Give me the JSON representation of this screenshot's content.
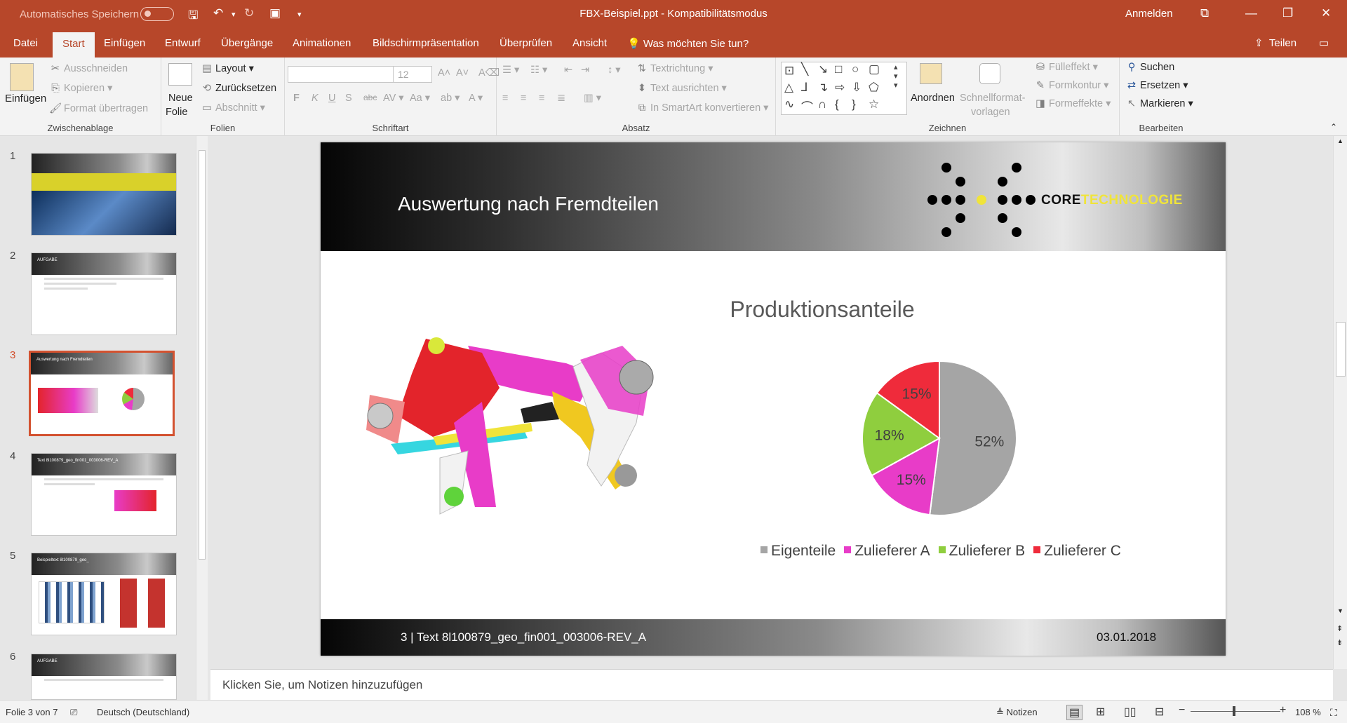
{
  "titlebar": {
    "autosave_label": "Automatisches Speichern",
    "document_title": "FBX-Beispiel.ppt - Kompatibilitätsmodus",
    "signin": "Anmelden"
  },
  "menu": {
    "tabs": [
      "Datei",
      "Start",
      "Einfügen",
      "Entwurf",
      "Übergänge",
      "Animationen",
      "Bildschirmpräsentation",
      "Überprüfen",
      "Ansicht"
    ],
    "active_tab": "Start",
    "tellme": "Was möchten Sie tun?",
    "share": "Teilen"
  },
  "ribbon": {
    "clipboard": {
      "paste": "Einfügen",
      "cut": "Ausschneiden",
      "copy": "Kopieren",
      "format_painter": "Format übertragen",
      "label": "Zwischenablage"
    },
    "slides": {
      "new_slide_1": "Neue",
      "new_slide_2": "Folie",
      "layout": "Layout",
      "reset": "Zurücksetzen",
      "section": "Abschnitt",
      "label": "Folien"
    },
    "font": {
      "size": "12",
      "bold": "F",
      "italic": "K",
      "underline": "U",
      "strike": "S",
      "shadow": "abc",
      "label": "Schriftart"
    },
    "paragraph": {
      "text_direction": "Textrichtung",
      "align_text": "Text ausrichten",
      "smartart": "In SmartArt konvertieren",
      "label": "Absatz"
    },
    "drawing": {
      "arrange": "Anordnen",
      "quick_styles_1": "Schnellformat-",
      "quick_styles_2": "vorlagen",
      "fill": "Fülleffekt",
      "outline": "Formkontur",
      "effects": "Formeffekte",
      "label": "Zeichnen"
    },
    "editing": {
      "find": "Suchen",
      "replace": "Ersetzen",
      "select": "Markieren",
      "label": "Bearbeiten"
    }
  },
  "thumbnails": {
    "numbers": [
      "1",
      "2",
      "3",
      "4",
      "5",
      "6"
    ],
    "selected": "3",
    "t2_title": "AUFGABE",
    "t3_title": "Auswertung nach Fremdteilen",
    "t4_title": "Text 8l100879_geo_fin001_003006-REV_A",
    "t5_title": "Beispieltext 8l100879_geo_",
    "t6_title": "AUFGABE"
  },
  "slide": {
    "title": "Auswertung nach Fremdteilen",
    "logo_core": "CORE",
    "logo_tech": "TECHNOLOGIE",
    "footer_left": "3  |  Text 8l100879_geo_fin001_003006-REV_A",
    "footer_date": "03.01.2018"
  },
  "chart_data": {
    "type": "pie",
    "title": "Produktionsanteile",
    "categories": [
      "Eigenteile",
      "Zulieferer A",
      "Zulieferer B",
      "Zulieferer C"
    ],
    "values": [
      52,
      15,
      18,
      15
    ],
    "labels": [
      "52%",
      "15%",
      "18%",
      "15%"
    ],
    "colors": [
      "#a5a5a5",
      "#e83cc8",
      "#8fce3e",
      "#ef2b3b"
    ],
    "legend_position": "bottom"
  },
  "notes_placeholder": "Klicken Sie, um Notizen hinzuzufügen",
  "statusbar": {
    "slide_info": "Folie 3 von 7",
    "language": "Deutsch (Deutschland)",
    "notes": "Notizen",
    "zoom": "108 %"
  }
}
